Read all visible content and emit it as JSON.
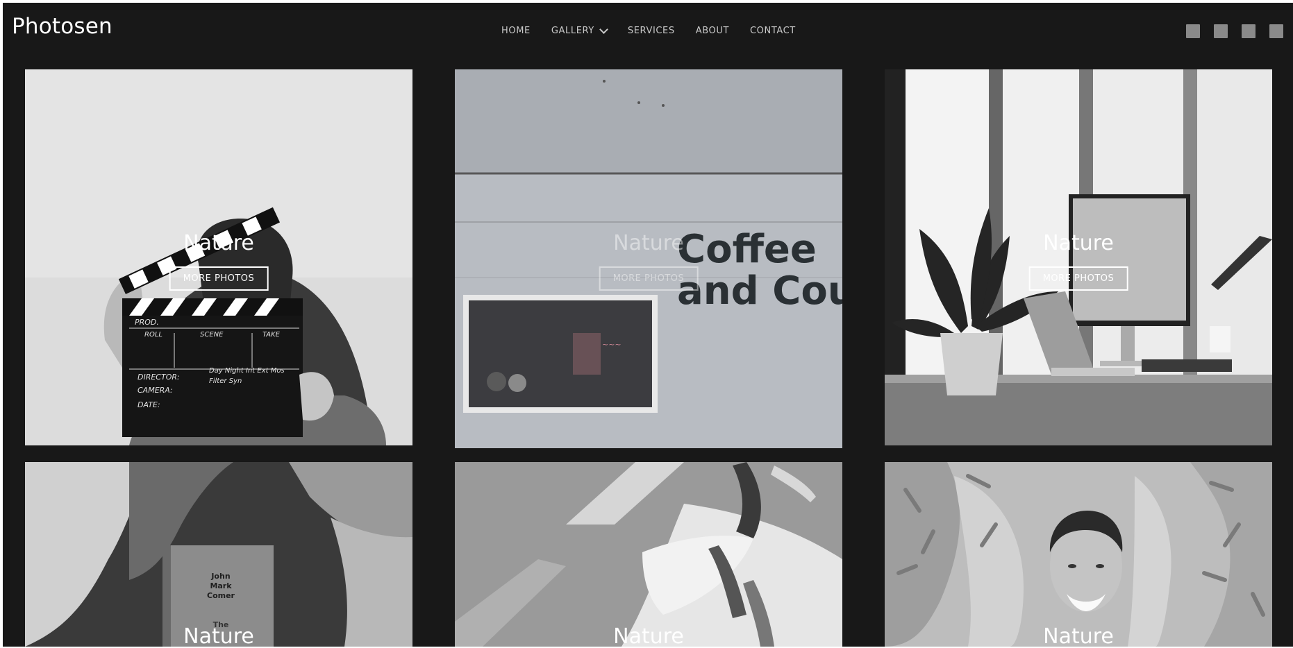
{
  "header": {
    "logo": "Photosen",
    "nav": [
      {
        "label": "HOME"
      },
      {
        "label": "GALLERY"
      },
      {
        "label": "SERVICES"
      },
      {
        "label": "ABOUT"
      },
      {
        "label": "CONTACT"
      }
    ],
    "social_icons": [
      "social-icon-1",
      "social-icon-2",
      "social-icon-3",
      "social-icon-4"
    ]
  },
  "gallery": {
    "cards": [
      {
        "title": "Nature",
        "button": "MORE PHOTOS",
        "image": "clapperboard"
      },
      {
        "title": "Nature",
        "button": "MORE PHOTOS",
        "image": "coffee-wall"
      },
      {
        "title": "Nature",
        "button": "MORE PHOTOS",
        "image": "desk-plant"
      },
      {
        "title": "Nature",
        "image": "book-clouds",
        "book_text": [
          "John",
          "Mark",
          "Comer",
          "The"
        ]
      },
      {
        "title": "Nature",
        "image": "woman-scarf"
      },
      {
        "title": "Nature",
        "image": "man-smiling"
      }
    ],
    "wall_sign": [
      "Coffee",
      "and Coup"
    ],
    "clapper_labels": [
      "PROD.",
      "ROLL",
      "SCENE",
      "TAKE",
      "DIRECTOR:",
      "CAMERA:",
      "DATE:",
      "Day Night Int Ext Mos",
      "Filter Syn"
    ]
  },
  "colors": {
    "background": "#181818",
    "text": "#ffffff",
    "nav_text": "#c9c9c9"
  }
}
